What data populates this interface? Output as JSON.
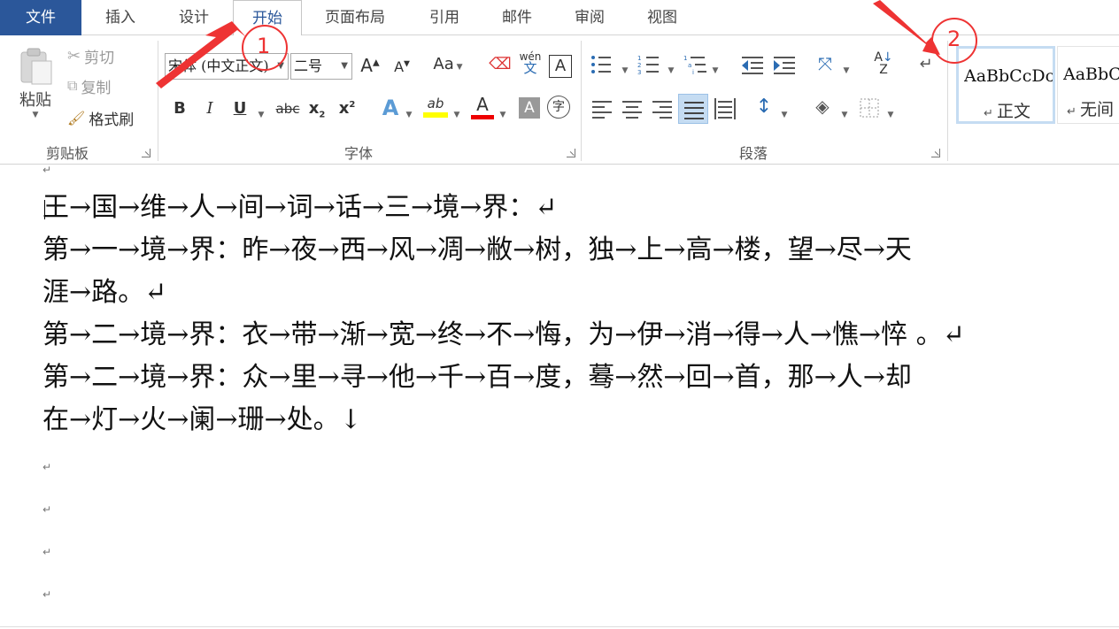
{
  "tabs": {
    "file": "文件",
    "insert": "插入",
    "design": "设计",
    "home": "开始",
    "layout": "页面布局",
    "references": "引用",
    "mailings": "邮件",
    "review": "审阅",
    "view": "视图"
  },
  "clipboard": {
    "paste": "粘贴",
    "cut": "剪切",
    "copy": "复制",
    "format_painter": "格式刷",
    "label": "剪贴板"
  },
  "font": {
    "name": "宋体 (中文正文)",
    "size": "二号",
    "grow": "A",
    "shrink": "A",
    "change_case": "Aa",
    "phonetic": "wén",
    "phonetic_char": "文",
    "border_char": "A",
    "bold": "B",
    "italic": "I",
    "underline": "U",
    "strike": "abc",
    "subscript": "x",
    "superscript": "x",
    "text_effects": "A",
    "highlight": "ab",
    "font_color": "A",
    "shading": "A",
    "enclose": "字",
    "label": "字体"
  },
  "paragraph": {
    "label": "段落"
  },
  "styles": {
    "normal_sample": "AaBbCcDc",
    "normal_name": "正文",
    "nospace_sample": "AaBbCc",
    "nospace_name": "无间"
  },
  "annotations": {
    "one": "1",
    "two": "2"
  },
  "document": {
    "lines": [
      "王→国→维→人→间→词→话→三→境→界：↵",
      "第→一→境→界：昨→夜→西→风→凋→敝→树，独→上→高→楼，望→尽→天",
      "涯→路。↵",
      "第→二→境→界：衣→带→渐→宽→终→不→悔，为→伊→消→得→人→憔→悴 。↵",
      "第→二→境→界：众→里→寻→他→千→百→度，蓦→然→回→首，那→人→却",
      "在→灯→火→阑→珊→处。↓"
    ],
    "empty_mark": "↵"
  },
  "colors": {
    "accent": "#2b579a",
    "annotation": "#e33333"
  }
}
